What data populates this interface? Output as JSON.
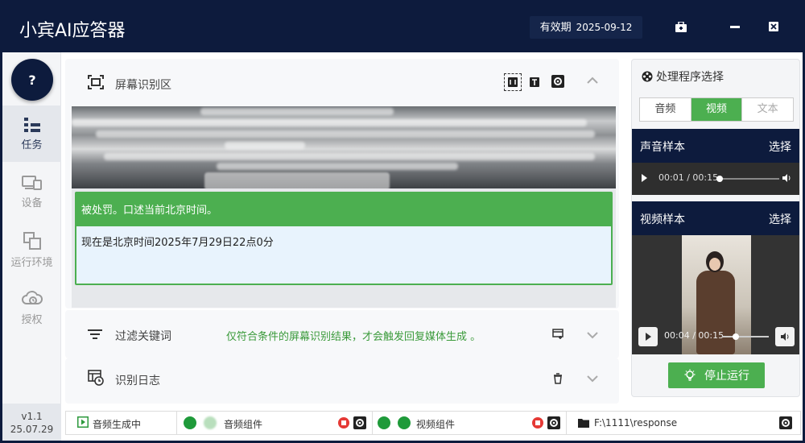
{
  "app": {
    "title": "小宾AI应答器",
    "validity_label": "有效期",
    "validity_date": "2025-09-12"
  },
  "sidebar": {
    "help_label": "?",
    "items": [
      {
        "label": "任务",
        "icon": "task-icon",
        "active": true
      },
      {
        "label": "设备",
        "icon": "device-icon",
        "active": false
      },
      {
        "label": "运行环境",
        "icon": "environment-icon",
        "active": false
      },
      {
        "label": "授权",
        "icon": "cloud-auth-icon",
        "active": false
      }
    ],
    "version": "v1.1",
    "build": "25.07.29"
  },
  "screen_panel": {
    "title": "屏幕识别区",
    "result_head": "被处罚。口述当前北京时间。",
    "result_body": "现在是北京时间2025年7月29日22点0分"
  },
  "filter_panel": {
    "title": "过滤关键词",
    "note": "仅符合条件的屏幕识别结果，才会触发回复媒体生成 。"
  },
  "log_panel": {
    "title": "识别日志"
  },
  "right_panel": {
    "title": "处理程序选择",
    "tabs": [
      "音频",
      "视频",
      "文本"
    ],
    "selected_tab": "视频",
    "audio_sample": {
      "title": "声音样本",
      "pick_label": "选择",
      "time": "00:01 / 00:15",
      "progress": 0.02
    },
    "video_sample": {
      "title": "视频样本",
      "pick_label": "选择",
      "time": "00:04 / 00:15",
      "progress": 0.3
    },
    "stop_label": "停止运行"
  },
  "statusbar": {
    "generating": "音频生成中",
    "audio_component": "音频组件",
    "video_component": "视频组件",
    "output_path": "F:\\1111\\response"
  },
  "colors": {
    "navy": "#0d1b3d",
    "green": "#4caf50",
    "stop_red": "#e53935"
  }
}
